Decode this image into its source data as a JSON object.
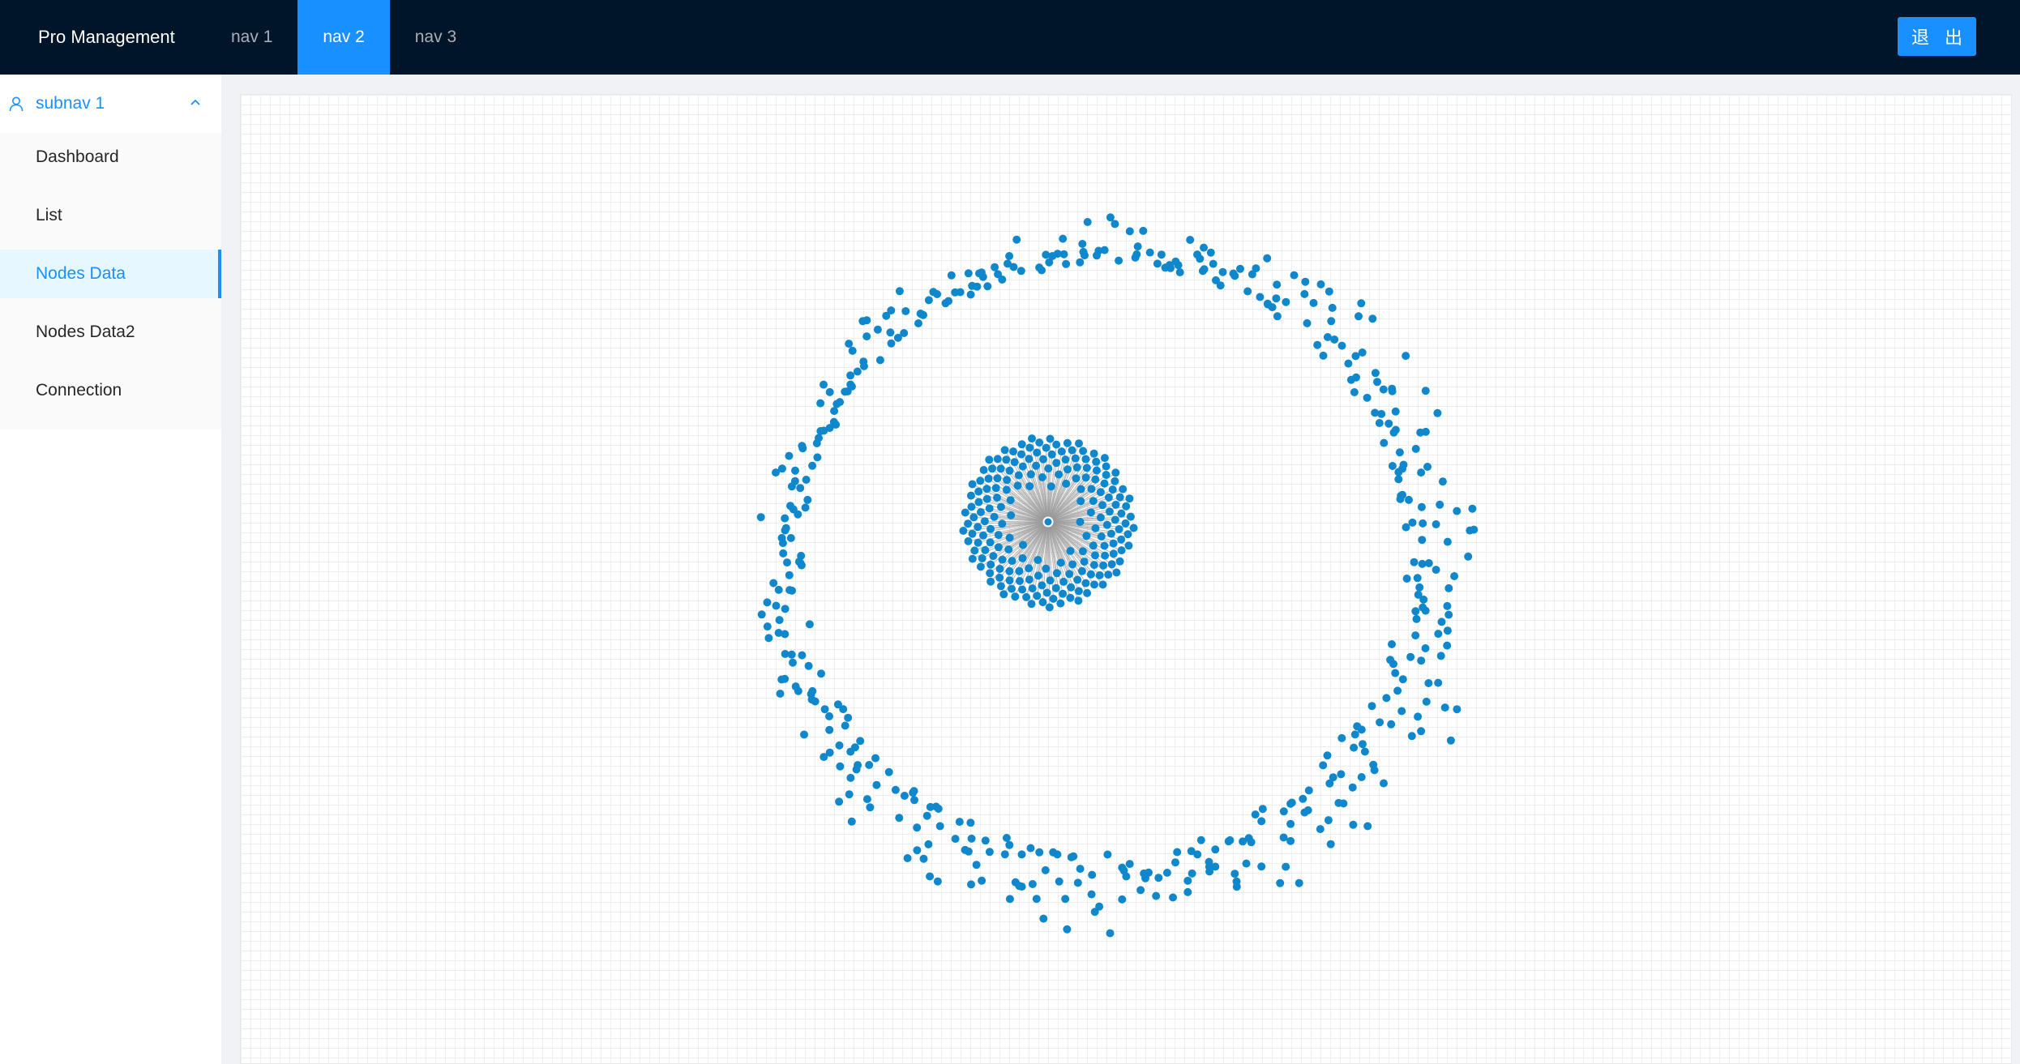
{
  "header": {
    "logo": "Pro Management",
    "nav": [
      {
        "label": "nav 1",
        "active": false
      },
      {
        "label": "nav 2",
        "active": true
      },
      {
        "label": "nav 3",
        "active": false
      }
    ],
    "logout_label": "退 出"
  },
  "sidebar": {
    "submenu": {
      "label": "subnav 1",
      "icon": "user-icon",
      "expanded": true
    },
    "items": [
      {
        "label": "Dashboard",
        "active": false
      },
      {
        "label": "List",
        "active": false
      },
      {
        "label": "Nodes Data",
        "active": true
      },
      {
        "label": "Nodes Data2",
        "active": false
      },
      {
        "label": "Connection",
        "active": false
      }
    ]
  },
  "graph": {
    "node_color": "#0f87cc",
    "edge_color": "#999999",
    "hub_node_count": 1,
    "inner_cluster_node_count": 200,
    "outer_ring_node_count": 460
  },
  "colors": {
    "header_bg": "#001529",
    "accent": "#1890ff",
    "sider_bg": "#ffffff"
  }
}
